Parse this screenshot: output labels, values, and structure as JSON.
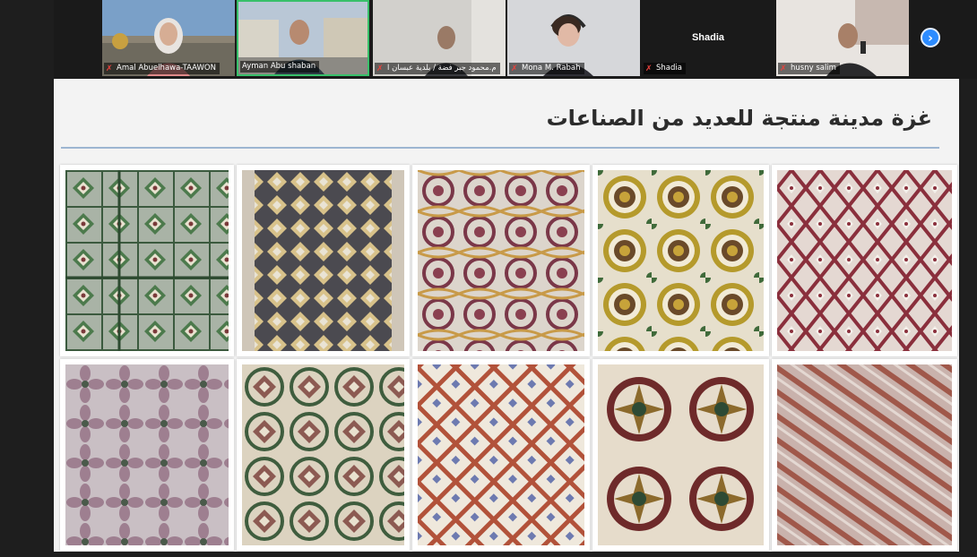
{
  "participants": [
    {
      "name": "Amal Abuelhawa-TAAWON",
      "muted": true,
      "video": true
    },
    {
      "name": "Ayman Abu shaban",
      "muted": false,
      "video": true,
      "active_speaker": true
    },
    {
      "name": "م.محمود جبر فضة / بلدية عبسان ا",
      "muted": true,
      "video": true
    },
    {
      "name": "Mona M. Rabah",
      "muted": true,
      "video": true
    },
    {
      "name": "Shadia",
      "muted": true,
      "video": false
    },
    {
      "name": "husny salim",
      "muted": true,
      "video": true
    }
  ],
  "next_page_icon": "chevron-right-icon",
  "slide": {
    "title": "غزة  مدينة منتجة للعديد من الصناعات",
    "photos": [
      {
        "description": "tile-pattern-green"
      },
      {
        "description": "tile-pattern-yellow-grid"
      },
      {
        "description": "tile-pattern-maroon-floral"
      },
      {
        "description": "tile-pattern-yellow-sun"
      },
      {
        "description": "tile-pattern-red-diamond"
      },
      {
        "description": "tile-pattern-pink-cross"
      },
      {
        "description": "tile-pattern-green-cream"
      },
      {
        "description": "tile-pattern-red-lattice"
      },
      {
        "description": "tile-pattern-dark-quatrefoil"
      },
      {
        "description": "tile-pattern-red-faded"
      }
    ]
  },
  "colors": {
    "active_speaker_border": "#38c06a",
    "muted_icon": "#e8423d",
    "nav_button": "#2d8cff",
    "title_rule": "#9db5d1"
  }
}
